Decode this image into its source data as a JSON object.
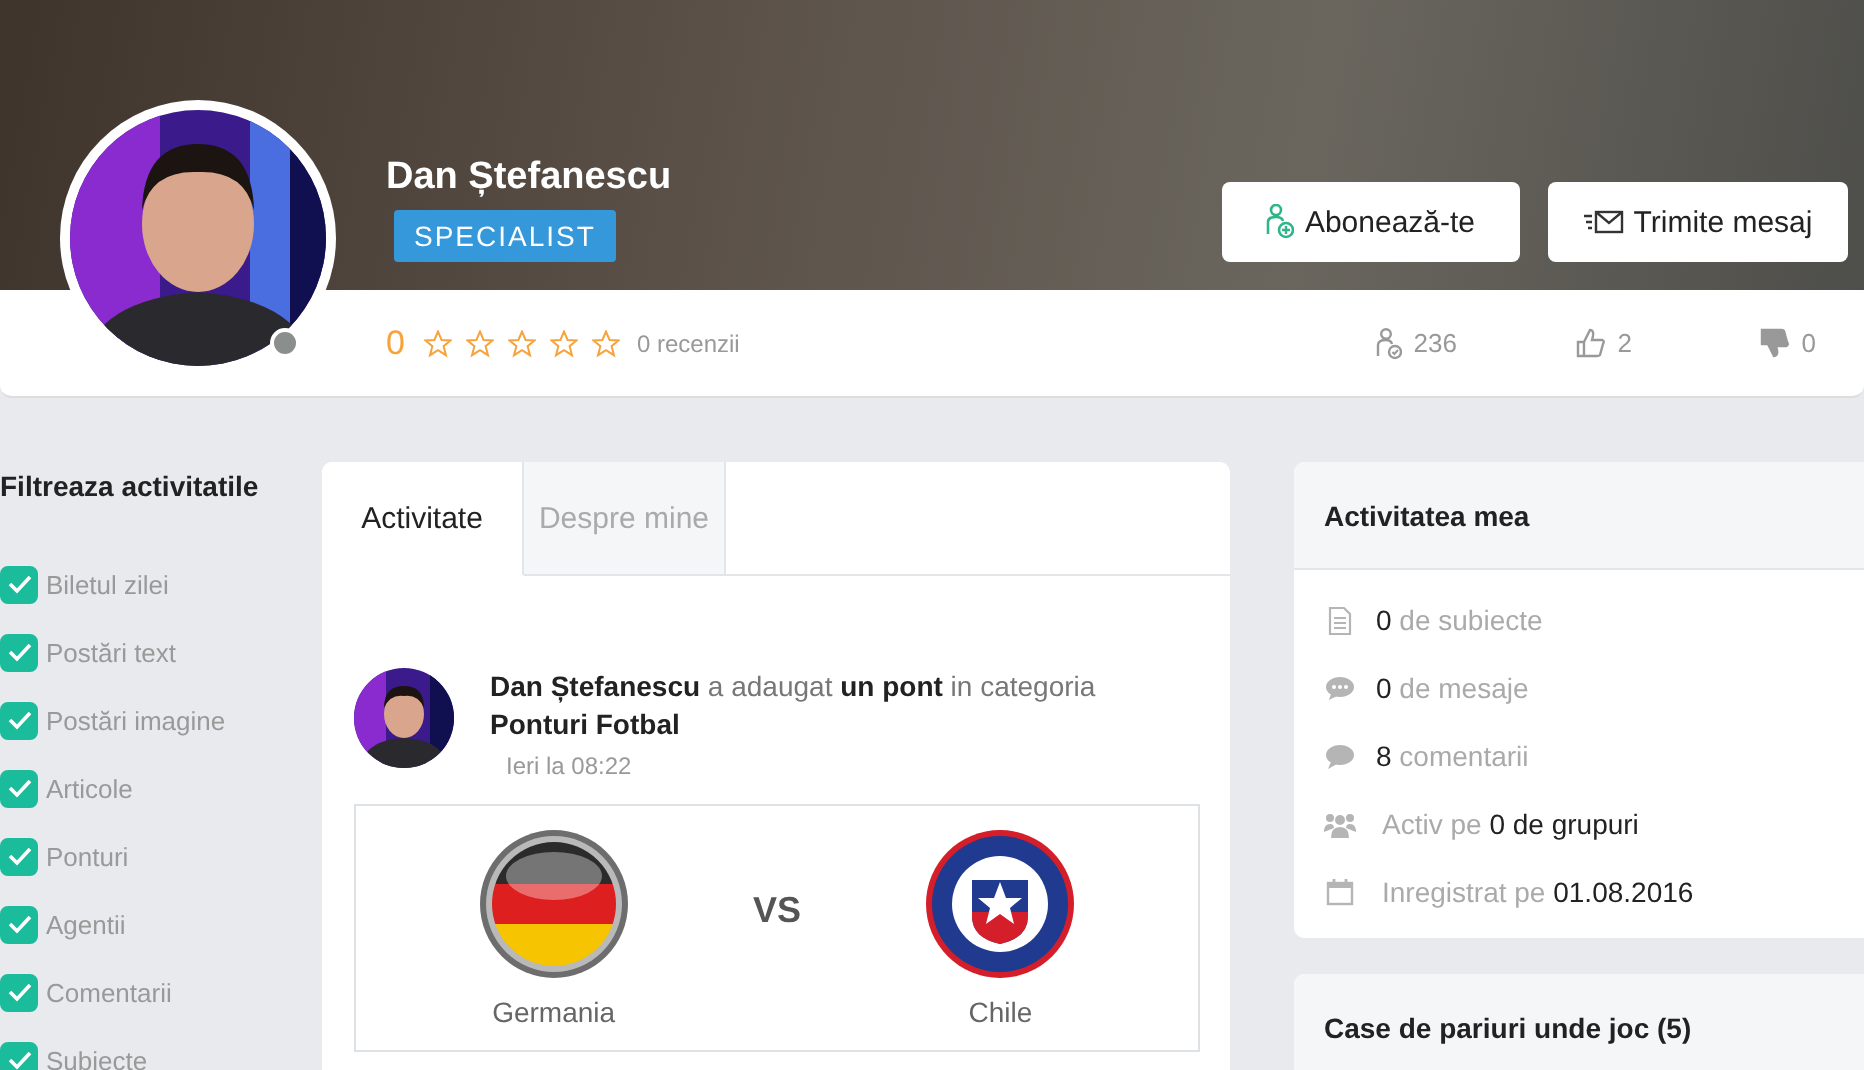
{
  "profile": {
    "name": "Dan Ștefanescu",
    "badge": "SPECIALIST",
    "online": false,
    "rating": "0",
    "stars": 0,
    "reviews": "0 recenzii"
  },
  "actions": [
    {
      "kind": "subscribe",
      "label": "Abonează-te"
    },
    {
      "kind": "message",
      "label": "Trimite mesaj"
    }
  ],
  "stats": [
    {
      "kind": "followers",
      "value": "236"
    },
    {
      "kind": "likes",
      "value": "2"
    },
    {
      "kind": "dislikes",
      "value": "0"
    }
  ],
  "filter": {
    "title": "Filtreaza activitatile",
    "items": [
      {
        "label": "Biletul zilei",
        "checked": true
      },
      {
        "label": "Postări text",
        "checked": true
      },
      {
        "label": "Postări imagine",
        "checked": true
      },
      {
        "label": "Articole",
        "checked": true
      },
      {
        "label": "Ponturi",
        "checked": true
      },
      {
        "label": "Agentii",
        "checked": true
      },
      {
        "label": "Comentarii",
        "checked": true
      },
      {
        "label": "Subiecte",
        "checked": true
      }
    ]
  },
  "tabs": [
    {
      "label": "Activitate",
      "selected": true
    },
    {
      "label": "Despre mine",
      "selected": false
    }
  ],
  "post": {
    "text": "**Dan Ștefanescu** a adaugat **un pont**  in categoria **Ponturi Fotbal**",
    "time": "Ieri la 08:22",
    "home": "Germania",
    "vs": "VS",
    "away": "Chile"
  },
  "my_activity": {
    "title": "Activitatea mea",
    "items": [
      {
        "kind": "document",
        "text": "**0** de subiecte"
      },
      {
        "kind": "chat",
        "text": "**0** de mesaje"
      },
      {
        "kind": "comment",
        "text": "**8** comentarii"
      },
      {
        "kind": "group",
        "text": "Activ pe **0 de grupuri**"
      },
      {
        "kind": "calendar",
        "text": "Inregistrat pe **01.08.2016**"
      }
    ]
  },
  "bookmakers": {
    "title": "Case de pariuri unde joc (5)"
  }
}
